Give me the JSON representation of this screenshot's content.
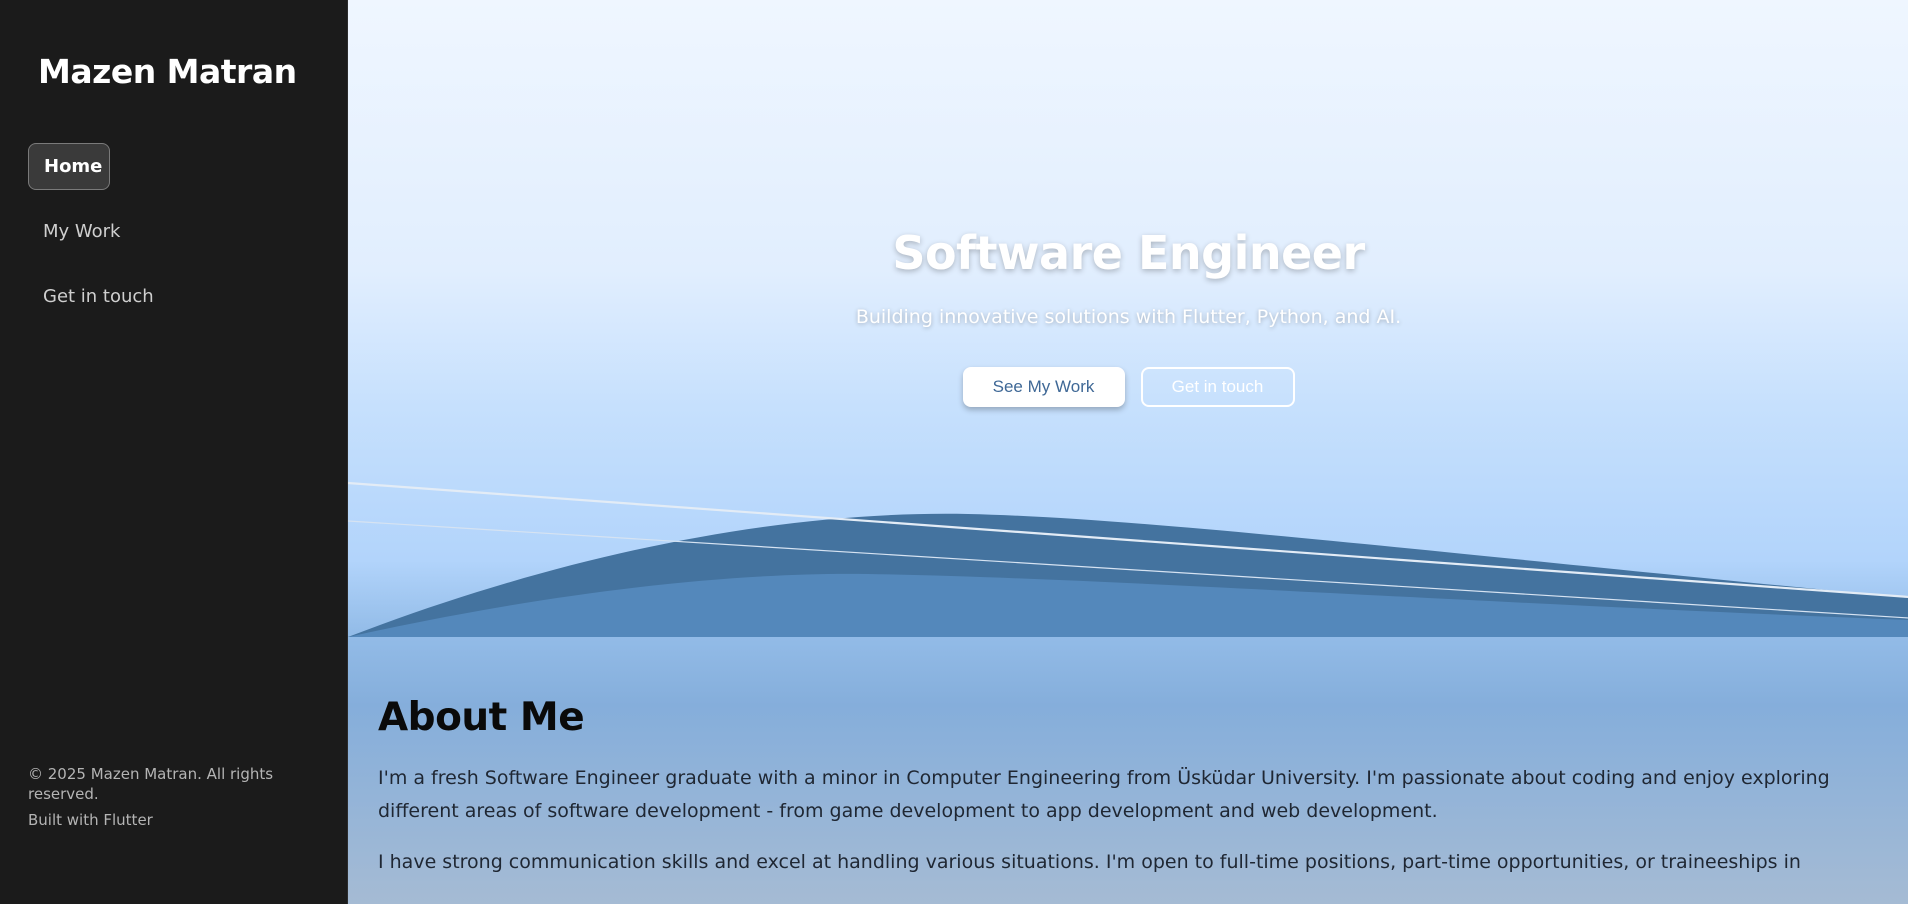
{
  "sidebar": {
    "brand": "Mazen Matran",
    "nav": [
      {
        "label": "Home",
        "active": true
      },
      {
        "label": "My Work",
        "active": false
      },
      {
        "label": "Get in touch",
        "active": false
      }
    ],
    "footer": {
      "copyright": "© 2025 Mazen Matran. All rights reserved.",
      "built_with": "Built with Flutter"
    }
  },
  "hero": {
    "title": "Software Engineer",
    "subtitle": "Building innovative solutions with Flutter, Python, and AI.",
    "primary_button": "See My Work",
    "secondary_button": "Get in touch"
  },
  "about": {
    "heading": "About Me",
    "paragraphs": [
      "I'm a fresh Software Engineer graduate with a minor in Computer Engineering from Üsküdar University. I'm passionate about coding and enjoy exploring different areas of software development - from game development to app development and web development.",
      "I have strong communication skills and excel at handling various situations. I'm open to full-time positions, part-time opportunities, or traineeships in"
    ]
  },
  "colors": {
    "sidebar_bg": "#1b1b1b",
    "wave_dark": "#44739f",
    "wave_light": "#5488bb",
    "accent_text": "#3f6896"
  }
}
